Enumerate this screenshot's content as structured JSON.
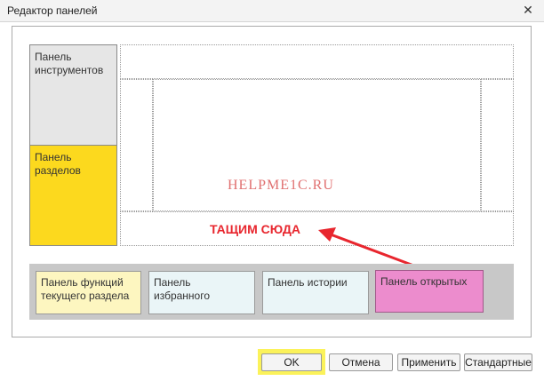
{
  "window": {
    "title": "Редактор панелей",
    "close_icon": "close-icon"
  },
  "layout": {
    "tools_panel": {
      "line1": "Панель",
      "line2": "инструментов"
    },
    "sections_panel": {
      "line1": "Панель",
      "line2": "разделов"
    },
    "watermark": "HELPME1C.RU",
    "drag_label": "ТАЩИМ СЮДА"
  },
  "available_panels": [
    {
      "line1": "Панель функций",
      "line2": "текущего раздела"
    },
    {
      "line1": "Панель",
      "line2": "избранного"
    },
    {
      "line1": "Панель истории",
      "line2": ""
    },
    {
      "line1": "Панель открытых",
      "line2": ""
    }
  ],
  "buttons": {
    "ok": "OK",
    "cancel": "Отмена",
    "apply": "Применить",
    "standard": "Стандартные"
  },
  "colors": {
    "sections_panel": "#fcd91e",
    "open_panel": "#ec8ccd",
    "arrow": "#e8262e",
    "ok_highlight": "#fbf25a"
  }
}
